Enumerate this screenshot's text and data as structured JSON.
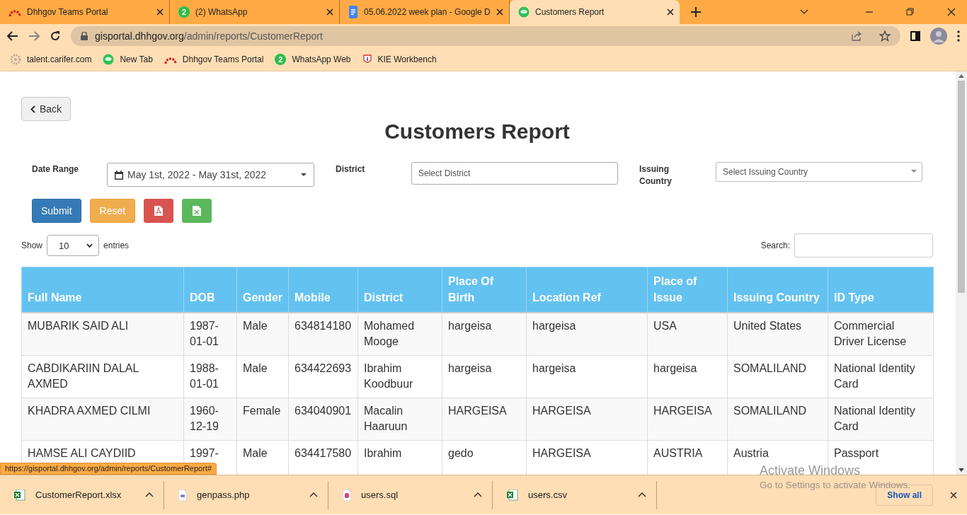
{
  "browser": {
    "tabs": [
      {
        "title": "Dhhgov Teams Portal",
        "selected": false
      },
      {
        "title": "(2) WhatsApp",
        "badge": "2",
        "selected": false
      },
      {
        "title": "05.06.2022 week plan - Google D",
        "selected": false
      },
      {
        "title": "Customers Report",
        "selected": true
      }
    ],
    "address": {
      "host": "gisportal.dhhgov.org",
      "path": "/admin/reports/CustomerReport"
    },
    "bookmarks": [
      {
        "label": "talent.carifer.com"
      },
      {
        "label": "New Tab"
      },
      {
        "label": "Dhhgov Teams Portal"
      },
      {
        "label": "WhatsApp Web",
        "badge": "2"
      },
      {
        "label": "KIE Workbench"
      }
    ]
  },
  "page": {
    "back_button": "Back",
    "title": "Customers Report",
    "filters": [
      {
        "kind": "daterange",
        "label": "Date Range",
        "value": "May 1st, 2022 - May 31st, 2022"
      },
      {
        "kind": "text",
        "label": "District",
        "placeholder": "Select District"
      },
      {
        "kind": "select",
        "label": "Issuing Country",
        "placeholder": "Select Issuing Country"
      }
    ],
    "buttons": [
      {
        "kind": "submit",
        "label": "Submit"
      },
      {
        "kind": "reset",
        "label": "Reset"
      },
      {
        "kind": "pdf"
      },
      {
        "kind": "excel"
      }
    ],
    "show_entries": {
      "before": "Show",
      "value": "10",
      "after": "entries"
    },
    "search": {
      "label": "Search:"
    },
    "table": {
      "columns": [
        "Full Name",
        "DOB",
        "Gender",
        "Mobile",
        "District",
        "Place Of Birth",
        "Location Ref",
        "Place of Issue",
        "Issuing Country",
        "ID Type"
      ],
      "rows": [
        [
          "MUBARIK SAID ALI",
          "1987-01-01",
          "Male",
          "634814180",
          "Mohamed Mooge",
          "hargeisa",
          "hargeisa",
          "USA",
          "United States",
          "Commercial Driver License"
        ],
        [
          "CABDIKARIIN DALAL AXMED",
          "1988-01-01",
          "Male",
          "634422693",
          "Ibrahim Koodbuur",
          "hargeisa",
          "hargeisa",
          "hargeisa",
          "SOMALILAND",
          "National Identity Card"
        ],
        [
          "KHADRA AXMED CILMI",
          "1960-12-19",
          "Female",
          "634040901",
          "Macalin Haaruun",
          "HARGEISA",
          "HARGEISA",
          "HARGEISA",
          "SOMALILAND",
          "National Identity Card"
        ],
        [
          "HAMSE ALI CAYDIID",
          "1997-",
          "Male",
          "634417580",
          "Ibrahim",
          "gedo",
          "HARGEISA",
          "AUSTRIA",
          "Austria",
          "Passport"
        ]
      ]
    }
  },
  "status_url": "https://gisportal.dhhgov.org/admin/reports/CustomerReport#",
  "downloads": [
    {
      "name": "CustomerReport.xlsx",
      "kind": "excel"
    },
    {
      "name": "genpass.php",
      "kind": "php"
    },
    {
      "name": "users.sql",
      "kind": "sql"
    },
    {
      "name": "users.csv",
      "kind": "excel"
    }
  ],
  "show_all": "Show all",
  "os_notice": {
    "title": "Activate Windows",
    "text": "Go to Settings to activate Windows."
  }
}
